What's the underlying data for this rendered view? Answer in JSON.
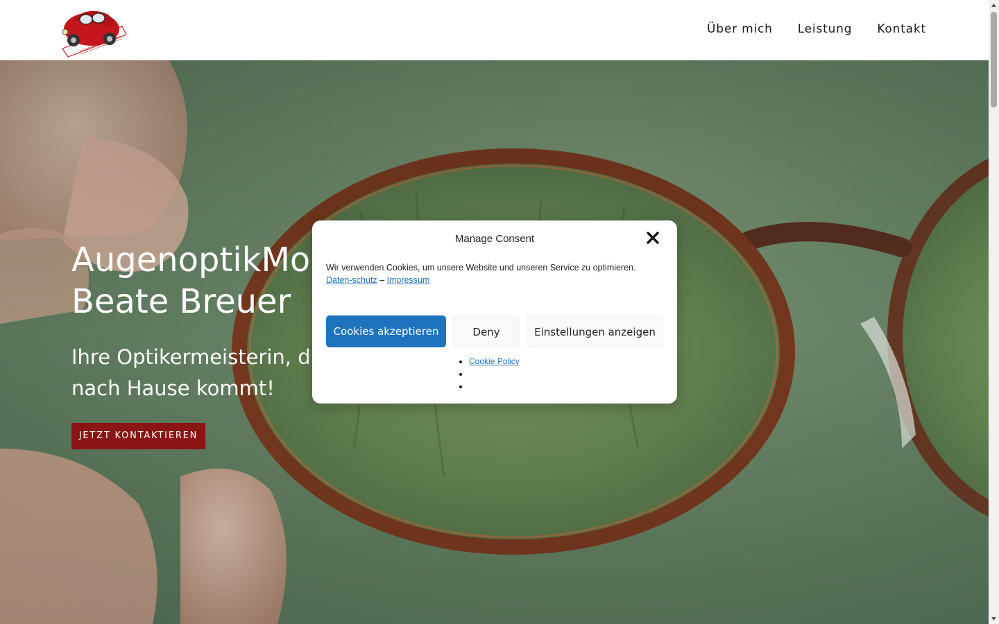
{
  "header": {
    "logo_icon": "red-beetle-car-logo",
    "nav": [
      {
        "label": "Über mich"
      },
      {
        "label": "Leistung"
      },
      {
        "label": "Kontakt"
      }
    ]
  },
  "hero": {
    "title": "AugenoptikMo",
    "title_line2": "Beate Breuer",
    "subtitle_line1": "Ihre Optikermeisterin, di",
    "subtitle_line2": "nach Hause kommt!",
    "cta_label": "JETZT KONTAKTIEREN",
    "background_icon": "eyeglasses-photo"
  },
  "consent": {
    "title": "Manage Consent",
    "close_icon": "close-icon",
    "message": "Wir verwenden Cookies, um unsere Website und unseren Service zu optimieren.",
    "privacy_link": "Daten-schutz",
    "separator": "–",
    "imprint_link": "Impressum",
    "accept_label": "Cookies akzeptieren",
    "deny_label": "Deny",
    "preferences_label": "Einstellungen anzeigen",
    "links": [
      "Cookie Policy",
      "",
      ""
    ]
  },
  "colors": {
    "accent_blue": "#1e73be",
    "cta_red": "#8b1414",
    "hero_green": "#6e8b6c"
  }
}
